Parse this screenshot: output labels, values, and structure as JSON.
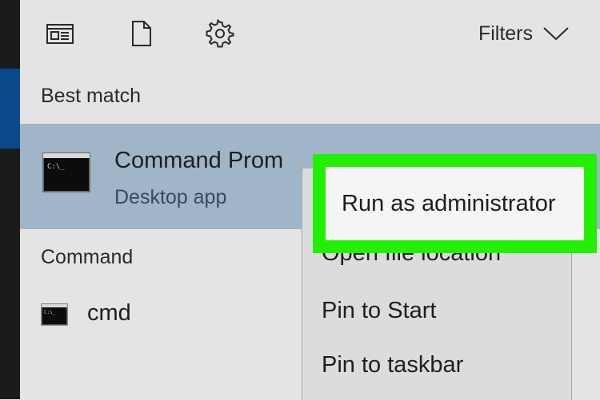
{
  "toolbar": {
    "icons": [
      "apps-icon",
      "documents-icon",
      "settings-gear-icon"
    ],
    "filters_label": "Filters"
  },
  "best_match": {
    "heading": "Best match",
    "app_title": "Command Prom",
    "app_subtitle": "Desktop app"
  },
  "command": {
    "heading": "Command",
    "item_label": "cmd"
  },
  "context_menu": {
    "items": [
      {
        "label": "Run as administrator",
        "highlighted": true
      },
      {
        "label": "Open file location"
      },
      {
        "label": "Pin to Start"
      },
      {
        "label": "Pin to taskbar"
      }
    ]
  },
  "colors": {
    "highlight_outline": "#22f000",
    "selected_row": "#a0b5c8",
    "accent_strip": "#0a4a8a"
  }
}
